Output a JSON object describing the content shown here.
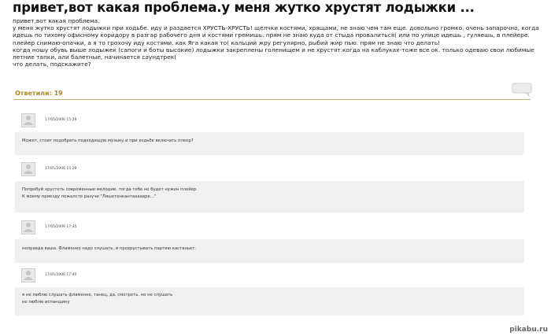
{
  "post": {
    "title": "привет,вот какая проблема.у меня жутко хрустят лодыжки ...",
    "lines": [
      "привет,вот какая проблема.",
      "у меня жутко хрустят лодыжки при ходьбе. иду и раздается ХРУСТЬ-ХРУСТЬ! щелчки костями, хрящами, не знаю чем там еще. довольно громко. очень запарочно, когда",
      "идешь по тихому офисному коридору в разгар рабочего дня и костями гремишь. прям не знаю куда от стыда провалиться( или по улице идешь , гуляешь, в плейере.",
      "плейер снимаю-опачки, а я то грохочу иду костями. как Яга какая то( кальций жру регулярно, рыбий жир пью. прям не знаю что делать!",
      "когда ношу обувь выше лодыжек (сапоги и боты высокие) лодыжки закреплены голенищем и не хрустят.когда на каблуках-тоже все ок. только одеваю свои любимые",
      "летние тапки, али балетные, начинается саундтрек(",
      "что делать, подскажите?"
    ]
  },
  "answers": {
    "label": "Ответили: 19"
  },
  "comments": [
    {
      "date": "17/05/2006 15:29",
      "lines": [
        "Может, стоит подобрать подходящую музыку и при ходьбе включать плеер?"
      ]
    },
    {
      "date": "17/05/2006 15:29",
      "lines": [
        "Попробуй хрустеть современные мелодии, тогда тебе не будет нужен плейер.",
        "К моему приезду пожалсто разучи \"Ляшетенкантаааааре...\""
      ]
    },
    {
      "date": "17/05/2006 17:35",
      "lines": [
        "неправда ваша. Фламенко надо слушать, и прохрустывать партию кастаньет."
      ]
    },
    {
      "date": "17/05/2006 17:40",
      "lines": [
        "я не люблю слушать фламенко, танец, да, смотреть, но не слушать",
        "не люблю испанщину"
      ]
    }
  ],
  "watermark": "pikabu.ru",
  "colors": {
    "accent": "#b38a2b",
    "comment_bg": "#f0f0f0"
  }
}
